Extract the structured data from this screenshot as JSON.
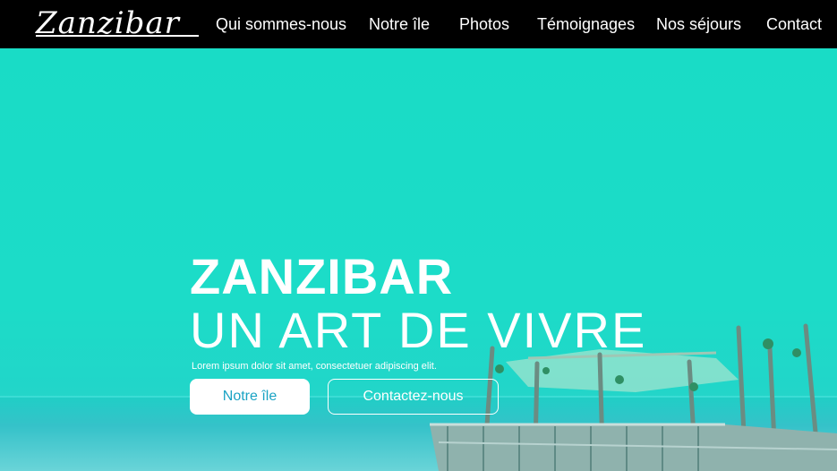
{
  "header": {
    "logo_text": "Zanzibar",
    "nav": [
      "Qui sommes-nous",
      "Notre île",
      "Photos",
      "Témoignages",
      "Nos séjours",
      "Contact"
    ]
  },
  "hero": {
    "title": "ZANZIBAR",
    "subtitle": "UN ART DE VIVRE",
    "text": "Lorem ipsum dolor sit amet, consectetuer adipiscing elit.",
    "primary_button": "Notre île",
    "secondary_button": "Contactez-nous"
  },
  "colors": {
    "nav_background": "#000000",
    "hero_background": "#1cdcc8",
    "primary_button_text": "#1aa3c4"
  }
}
